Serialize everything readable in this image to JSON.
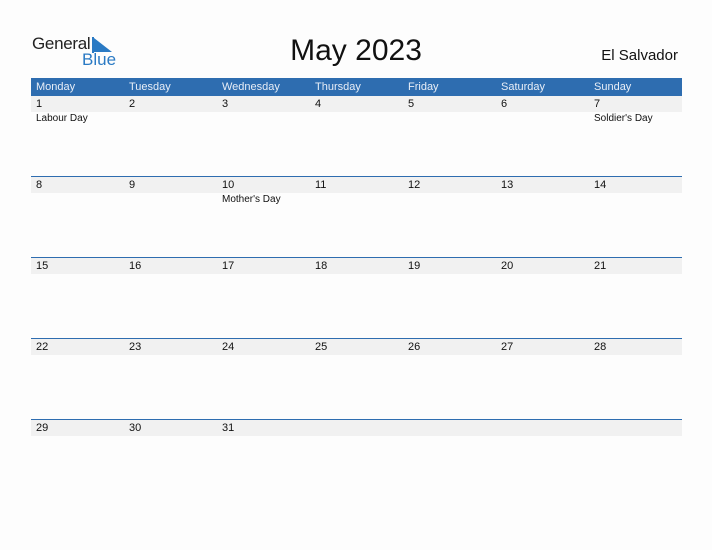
{
  "logo": {
    "general": "General",
    "blue": "Blue"
  },
  "title": "May 2023",
  "country": "El Salvador",
  "colors": {
    "header_bg": "#2e6db0",
    "accent": "#2a7ac4",
    "row_bg": "#f1f1f1"
  },
  "weekdays": [
    "Monday",
    "Tuesday",
    "Wednesday",
    "Thursday",
    "Friday",
    "Saturday",
    "Sunday"
  ],
  "weeks": [
    {
      "days": [
        "1",
        "2",
        "3",
        "4",
        "5",
        "6",
        "7"
      ],
      "events": [
        "Labour Day",
        "",
        "",
        "",
        "",
        "",
        "Soldier's Day"
      ]
    },
    {
      "days": [
        "8",
        "9",
        "10",
        "11",
        "12",
        "13",
        "14"
      ],
      "events": [
        "",
        "",
        "Mother's Day",
        "",
        "",
        "",
        ""
      ]
    },
    {
      "days": [
        "15",
        "16",
        "17",
        "18",
        "19",
        "20",
        "21"
      ],
      "events": [
        "",
        "",
        "",
        "",
        "",
        "",
        ""
      ]
    },
    {
      "days": [
        "22",
        "23",
        "24",
        "25",
        "26",
        "27",
        "28"
      ],
      "events": [
        "",
        "",
        "",
        "",
        "",
        "",
        ""
      ]
    },
    {
      "days": [
        "29",
        "30",
        "31",
        "",
        "",
        "",
        ""
      ],
      "events": [
        "",
        "",
        "",
        "",
        "",
        "",
        ""
      ]
    }
  ]
}
